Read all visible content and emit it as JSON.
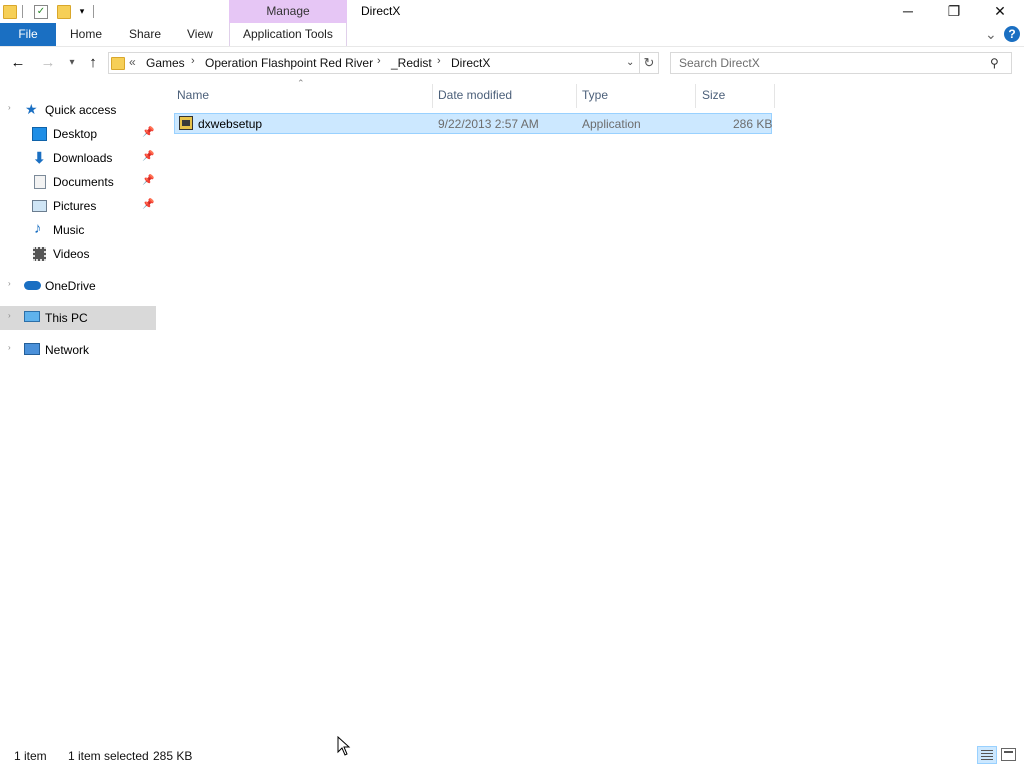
{
  "window": {
    "title": "DirectX",
    "contextual_tab": "Manage",
    "controls": {
      "minimize": "─",
      "maximize": "❐",
      "close": "✕"
    }
  },
  "ribbon": {
    "tabs": [
      "File",
      "Home",
      "Share",
      "View",
      "Application Tools"
    ],
    "collapse_icon": "⌄",
    "help_icon": "?"
  },
  "address": {
    "overflow": "«",
    "crumbs": [
      "Games",
      "Operation Flashpoint Red River",
      "_Redist",
      "DirectX"
    ],
    "separator": "›"
  },
  "search": {
    "placeholder": "Search DirectX"
  },
  "nav_pane": {
    "quick_access": "Quick access",
    "items": [
      {
        "label": "Desktop",
        "icon": "desktop-icon",
        "pinned": true
      },
      {
        "label": "Downloads",
        "icon": "downloads-icon",
        "pinned": true
      },
      {
        "label": "Documents",
        "icon": "documents-icon",
        "pinned": true
      },
      {
        "label": "Pictures",
        "icon": "pictures-icon",
        "pinned": true
      },
      {
        "label": "Music",
        "icon": "music-icon",
        "pinned": false
      },
      {
        "label": "Videos",
        "icon": "videos-icon",
        "pinned": false
      }
    ],
    "onedrive": "OneDrive",
    "this_pc": "This PC",
    "network": "Network"
  },
  "columns": {
    "name": "Name",
    "date": "Date modified",
    "type": "Type",
    "size": "Size"
  },
  "files": [
    {
      "name": "dxwebsetup",
      "date": "9/22/2013 2:57 AM",
      "type": "Application",
      "size": "286 KB",
      "selected": true
    }
  ],
  "status": {
    "count": "1 item",
    "selection": "1 item selected",
    "selection_size": "285 KB"
  },
  "colors": {
    "accent": "#1a6fc2",
    "selection": "#cce8ff",
    "manage_tab": "#e6c6f5"
  }
}
